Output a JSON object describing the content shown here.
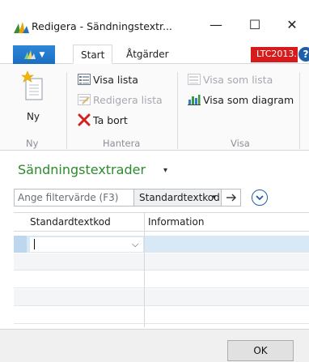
{
  "window": {
    "title": "Redigera - Sändningstextr...",
    "minimize": "—",
    "maximize": "☐",
    "close": "✕"
  },
  "ribbon": {
    "tabs": [
      {
        "label": "Start",
        "active": true
      },
      {
        "label": "Åtgärder",
        "active": false
      }
    ],
    "company": "LTC2013...",
    "help": "?",
    "groups": {
      "ny": {
        "label": "Ny",
        "new_button": "Ny"
      },
      "hantera": {
        "label": "Hantera",
        "view_list": "Visa lista",
        "edit_list": "Redigera lista",
        "delete": "Ta bort"
      },
      "visa": {
        "label": "Visa",
        "show_as_list": "Visa som lista",
        "show_as_chart": "Visa som diagram"
      }
    }
  },
  "page": {
    "title": "Sändningstextrader",
    "title_caret": "▾"
  },
  "filter": {
    "placeholder": "Ange filtervärde (F3)",
    "field": "Standardtextkod",
    "field_caret": "▾"
  },
  "grid": {
    "columns": [
      "Standardtextkod",
      "Information"
    ],
    "rows": [
      {
        "standardtextkod": "",
        "information": "",
        "selected": true
      },
      {
        "standardtextkod": "",
        "information": ""
      },
      {
        "standardtextkod": "",
        "information": ""
      },
      {
        "standardtextkod": "",
        "information": ""
      },
      {
        "standardtextkod": "",
        "information": ""
      }
    ],
    "editor_caret": "⌵"
  },
  "footer": {
    "ok_label": "OK"
  },
  "colors": {
    "accent_blue": "#1e5fa8",
    "title_green": "#2d8a2d",
    "company_red": "#d51b1b",
    "selected_row": "#d7e9f7"
  },
  "icons": {
    "app_logo": "dynamics-nav-logo",
    "new": "new-document-star-icon",
    "view_list": "list-view-icon",
    "edit_list": "edit-list-icon",
    "delete": "red-x-delete-icon",
    "show_as_list": "list-icon",
    "show_as_chart": "bar-chart-icon",
    "filter_go": "arrow-right-icon",
    "filter_expand": "chevron-down-circle-icon"
  }
}
